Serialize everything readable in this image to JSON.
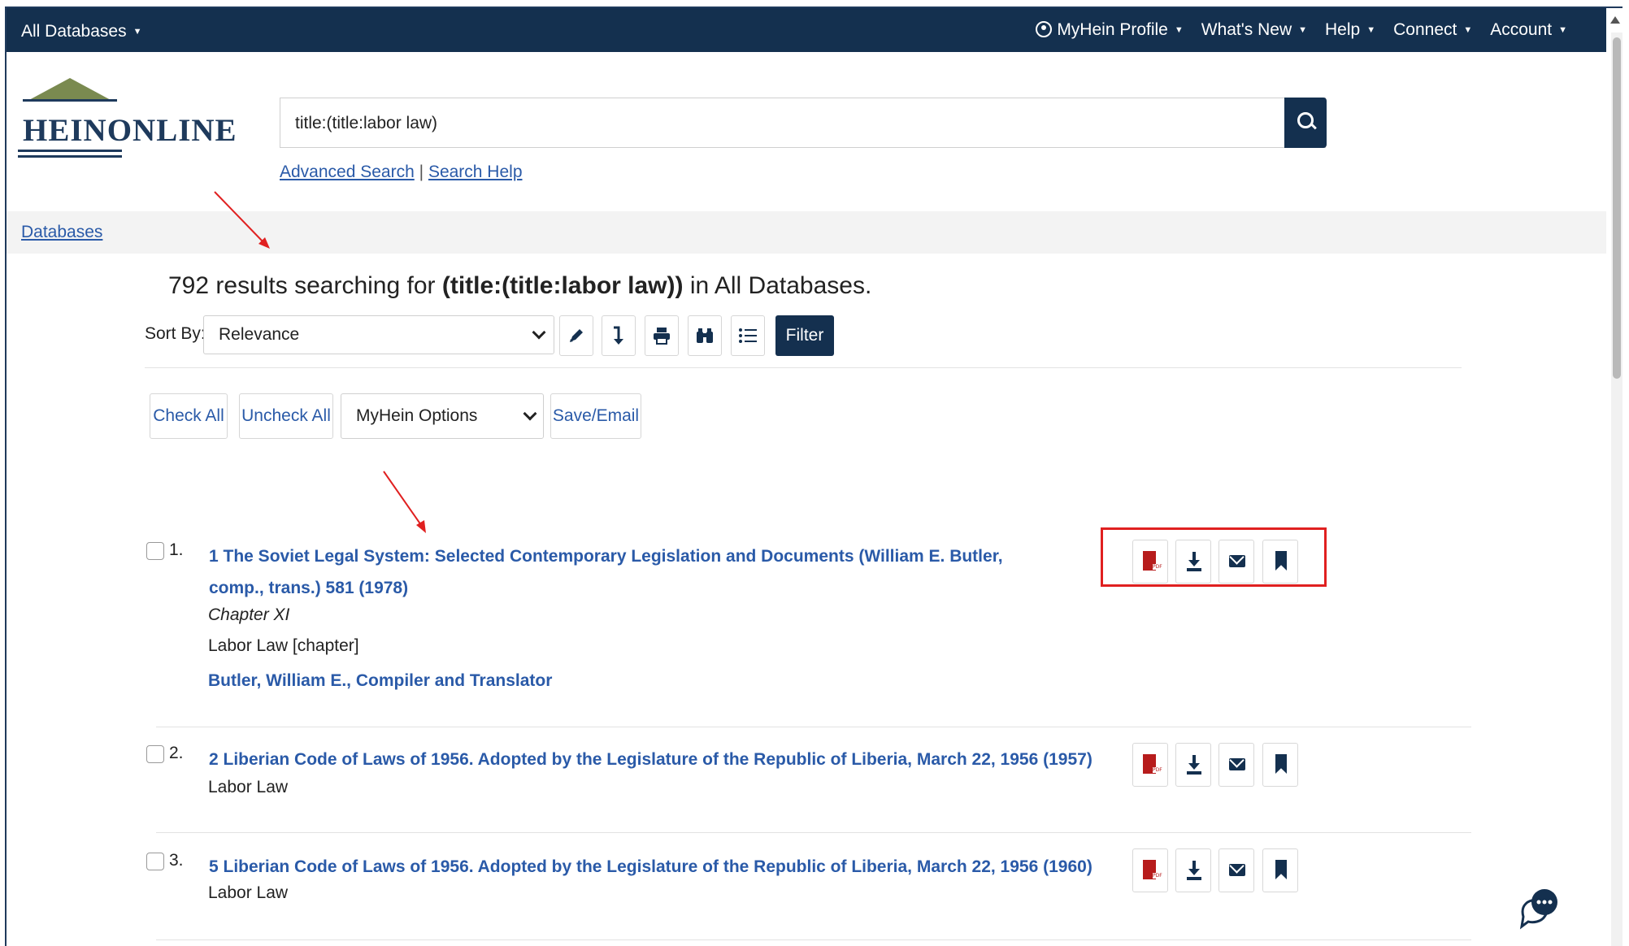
{
  "topbar": {
    "databases": "All Databases",
    "myhein_profile": "MyHein Profile",
    "whats_new": "What's New",
    "help": "Help",
    "connect": "Connect",
    "account": "Account"
  },
  "logo": {
    "text": "HEINONLINE"
  },
  "search": {
    "value": "title:(title:labor law)",
    "advanced_link": "Advanced Search",
    "separator": "|",
    "help_link": "Search Help"
  },
  "breadcrumb": {
    "databases": "Databases"
  },
  "results_header": {
    "prefix": "792 results searching for ",
    "query": "(title:(title:labor law))",
    "suffix": " in All Databases."
  },
  "sort": {
    "label": "Sort By:",
    "selected": "Relevance",
    "filter_label": "Filter"
  },
  "actions": {
    "check_all": "Check All",
    "uncheck_all": "Uncheck All",
    "myhein_options": "MyHein Options",
    "save_email": "Save/Email"
  },
  "results": [
    {
      "num": "1.",
      "title": "1 The Soviet Legal System: Selected Contemporary Legislation and Documents (William E. Butler, comp., trans.) 581 (1978)",
      "chapter": "Chapter XI",
      "subtitle": "Labor Law [chapter]",
      "author": "Butler, William E., Compiler and Translator"
    },
    {
      "num": "2.",
      "title": "2 Liberian Code of Laws of 1956. Adopted by the Legislature of the Republic of Liberia, March 22, 1956 (1957)",
      "subtitle": "Labor Law"
    },
    {
      "num": "3.",
      "title": "5 Liberian Code of Laws of 1956. Adopted by the Legislature of the Republic of Liberia, March 22, 1956 (1960)",
      "subtitle": "Labor Law"
    }
  ],
  "colors": {
    "navy": "#14304f",
    "link": "#2a5aa8",
    "annotation_red": "#e02020",
    "pdf_red": "#b71c1c"
  },
  "icons": [
    "person-icon",
    "search-icon",
    "pencil-icon",
    "sort-direction-icon",
    "print-icon",
    "binoculars-icon",
    "list-icon",
    "pdf-icon",
    "download-icon",
    "email-icon",
    "bookmark-icon",
    "chat-icon"
  ]
}
